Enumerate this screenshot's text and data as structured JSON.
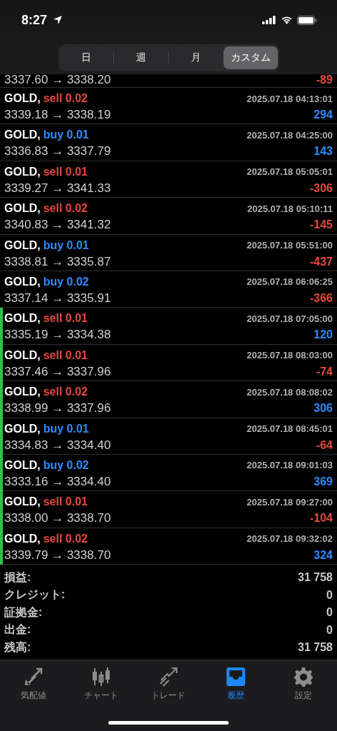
{
  "status_bar": {
    "time": "8:27"
  },
  "period_tabs": [
    {
      "label": "日",
      "selected": false
    },
    {
      "label": "週",
      "selected": false
    },
    {
      "label": "月",
      "selected": false
    },
    {
      "label": "カスタム",
      "selected": true
    }
  ],
  "partial_row": {
    "prices": "3337.60 → 3338.20",
    "profit": "-89",
    "loss": true
  },
  "trades": [
    {
      "symbol": "GOLD,",
      "order": "sell 0.02",
      "buy": false,
      "time": "2025.07.18 04:13:01",
      "prices": "3339.18 → 3338.19",
      "profit": "294",
      "loss": false,
      "marked": false
    },
    {
      "symbol": "GOLD,",
      "order": "buy 0.01",
      "buy": true,
      "time": "2025.07.18 04:25:00",
      "prices": "3336.83 → 3337.79",
      "profit": "143",
      "loss": false,
      "marked": false
    },
    {
      "symbol": "GOLD,",
      "order": "sell 0.01",
      "buy": false,
      "time": "2025.07.18 05:05:01",
      "prices": "3339.27 → 3341.33",
      "profit": "-306",
      "loss": true,
      "marked": false
    },
    {
      "symbol": "GOLD,",
      "order": "sell 0.02",
      "buy": false,
      "time": "2025.07.18 05:10:11",
      "prices": "3340.83 → 3341.32",
      "profit": "-145",
      "loss": true,
      "marked": false
    },
    {
      "symbol": "GOLD,",
      "order": "buy 0.01",
      "buy": true,
      "time": "2025.07.18 05:51:00",
      "prices": "3338.81 → 3335.87",
      "profit": "-437",
      "loss": true,
      "marked": false
    },
    {
      "symbol": "GOLD,",
      "order": "buy 0.02",
      "buy": true,
      "time": "2025.07.18 06:06:25",
      "prices": "3337.14 → 3335.91",
      "profit": "-366",
      "loss": true,
      "marked": false
    },
    {
      "symbol": "GOLD,",
      "order": "sell 0.01",
      "buy": false,
      "time": "2025.07.18 07:05:00",
      "prices": "3335.19 → 3334.38",
      "profit": "120",
      "loss": false,
      "marked": true
    },
    {
      "symbol": "GOLD,",
      "order": "sell 0.01",
      "buy": false,
      "time": "2025.07.18 08:03:00",
      "prices": "3337.46 → 3337.96",
      "profit": "-74",
      "loss": true,
      "marked": true
    },
    {
      "symbol": "GOLD,",
      "order": "sell 0.02",
      "buy": false,
      "time": "2025.07.18 08:08:02",
      "prices": "3338.99 → 3337.96",
      "profit": "306",
      "loss": false,
      "marked": true
    },
    {
      "symbol": "GOLD,",
      "order": "buy 0.01",
      "buy": true,
      "time": "2025.07.18 08:45:01",
      "prices": "3334.83 → 3334.40",
      "profit": "-64",
      "loss": true,
      "marked": true
    },
    {
      "symbol": "GOLD,",
      "order": "buy 0.02",
      "buy": true,
      "time": "2025.07.18 09:01:03",
      "prices": "3333.16 → 3334.40",
      "profit": "369",
      "loss": false,
      "marked": true
    },
    {
      "symbol": "GOLD,",
      "order": "sell 0.01",
      "buy": false,
      "time": "2025.07.18 09:27:00",
      "prices": "3338.00 → 3338.70",
      "profit": "-104",
      "loss": true,
      "marked": true
    },
    {
      "symbol": "GOLD,",
      "order": "sell 0.02",
      "buy": false,
      "time": "2025.07.18 09:32:02",
      "prices": "3339.79 → 3338.70",
      "profit": "324",
      "loss": false,
      "marked": true
    }
  ],
  "summary": [
    {
      "label": "損益:",
      "value": "31 758"
    },
    {
      "label": "クレジット:",
      "value": "0"
    },
    {
      "label": "証拠金:",
      "value": "0"
    },
    {
      "label": "出金:",
      "value": "0"
    },
    {
      "label": "残高:",
      "value": "31 758"
    }
  ],
  "tab_bar": [
    {
      "kind": "quotes",
      "label": "気配値",
      "selected": false
    },
    {
      "kind": "chart",
      "label": "チャート",
      "selected": false
    },
    {
      "kind": "trade",
      "label": "トレード",
      "selected": false
    },
    {
      "kind": "history",
      "label": "履歴",
      "selected": true
    },
    {
      "kind": "settings",
      "label": "設定",
      "selected": false
    }
  ]
}
